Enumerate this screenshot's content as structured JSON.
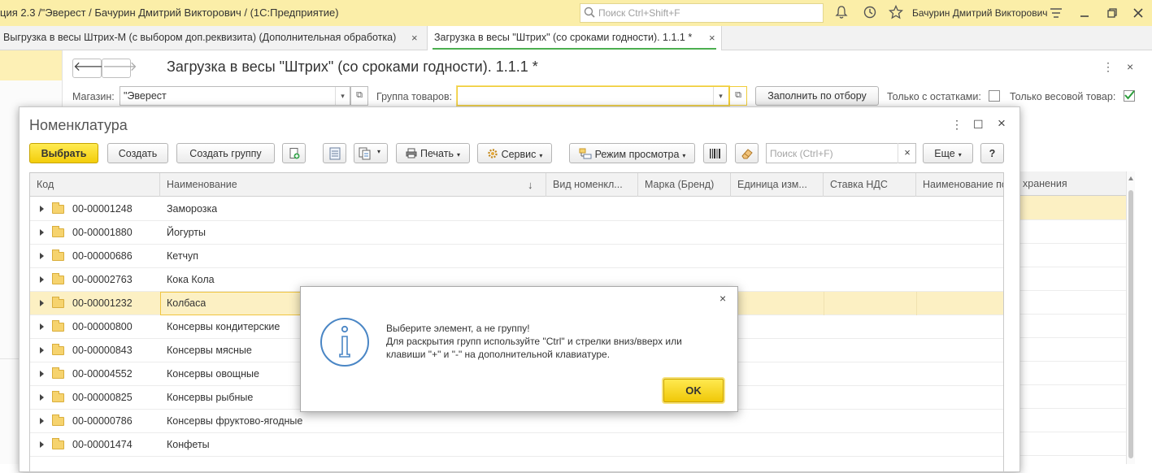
{
  "app": {
    "title": "ция 2.3 /\"Эверест / Бачурин Дмитрий Викторович /  (1С:Предприятие)",
    "search_placeholder": "Поиск Ctrl+Shift+F",
    "user": "Бачурин Дмитрий Викторович",
    "icons": [
      "bell-icon",
      "history-icon",
      "star-icon",
      "menu-icon",
      "minimize-icon",
      "restore-icon",
      "close-icon"
    ]
  },
  "tabs": [
    {
      "label": "Выгрузка в весы Штрих-М (с выбором доп.реквизита) (Дополнительная обработка)",
      "close": "×"
    },
    {
      "label": "Загрузка в весы \"Штрих\" (со сроками годности). 1.1.1 *",
      "close": "×",
      "active": true
    }
  ],
  "form": {
    "back": "🡐",
    "forward": "🡒",
    "title": "Загрузка в весы \"Штрих\" (со сроками годности). 1.1.1 *",
    "more": "⋮",
    "close": "×",
    "store_label": "Магазин:",
    "store_value": "\"Эверест",
    "group_label": "Группа товаров:",
    "group_value": "",
    "fill_button": "Заполнить по отбору",
    "only_stock_label": "Только с остатками:",
    "only_stock_checked": false,
    "only_weight_label": "Только весовой товар:",
    "only_weight_checked": true,
    "bg_col_header": "хранения"
  },
  "dialog": {
    "title": "Номенклатура",
    "more": "⋮",
    "maximize": "☐",
    "close": "×",
    "toolbar": {
      "select": "Выбрать",
      "create": "Создать",
      "create_group": "Создать группу",
      "print": "Печать",
      "service": "Сервис",
      "view_mode": "Режим просмотра",
      "search_placeholder": "Поиск (Ctrl+F)",
      "search_clear": "×",
      "more": "Еще",
      "help": "?"
    },
    "columns": [
      "Код",
      "Наименование",
      "Вид номенкл...",
      "Марка (Бренд)",
      "Единица изм...",
      "Ставка НДС",
      "Наименование по..."
    ],
    "sort_indicator": "↓",
    "rows": [
      {
        "code": "00-00001248",
        "name": "Заморозка"
      },
      {
        "code": "00-00001880",
        "name": "Йогурты"
      },
      {
        "code": "00-00000686",
        "name": "Кетчуп"
      },
      {
        "code": "00-00002763",
        "name": "Кока Кола"
      },
      {
        "code": "00-00001232",
        "name": "Колбаса",
        "selected": true
      },
      {
        "code": "00-00000800",
        "name": "Консервы кондитерские"
      },
      {
        "code": "00-00000843",
        "name": "Консервы мясные"
      },
      {
        "code": "00-00004552",
        "name": "Консервы овощные"
      },
      {
        "code": "00-00000825",
        "name": "Консервы рыбные"
      },
      {
        "code": "00-00000786",
        "name": "Консервы фруктово-ягодные"
      },
      {
        "code": "00-00001474",
        "name": "Конфеты"
      }
    ]
  },
  "message": {
    "close": "×",
    "line1": "Выберите элемент, а не группу!",
    "line2": "Для раскрытия групп используйте \"Ctrl\" и стрелки вниз/вверх или",
    "line3": "клавиши \"+\" и \"-\" на дополнительной клавиатуре.",
    "ok": "OK"
  },
  "colors": {
    "titlebar": "#fbeea8",
    "accent_yellow": "#f3cd0a",
    "selected_row": "#fcf0c3",
    "active_tab_underline": "#4caf50",
    "info_icon": "#4a86c5"
  }
}
